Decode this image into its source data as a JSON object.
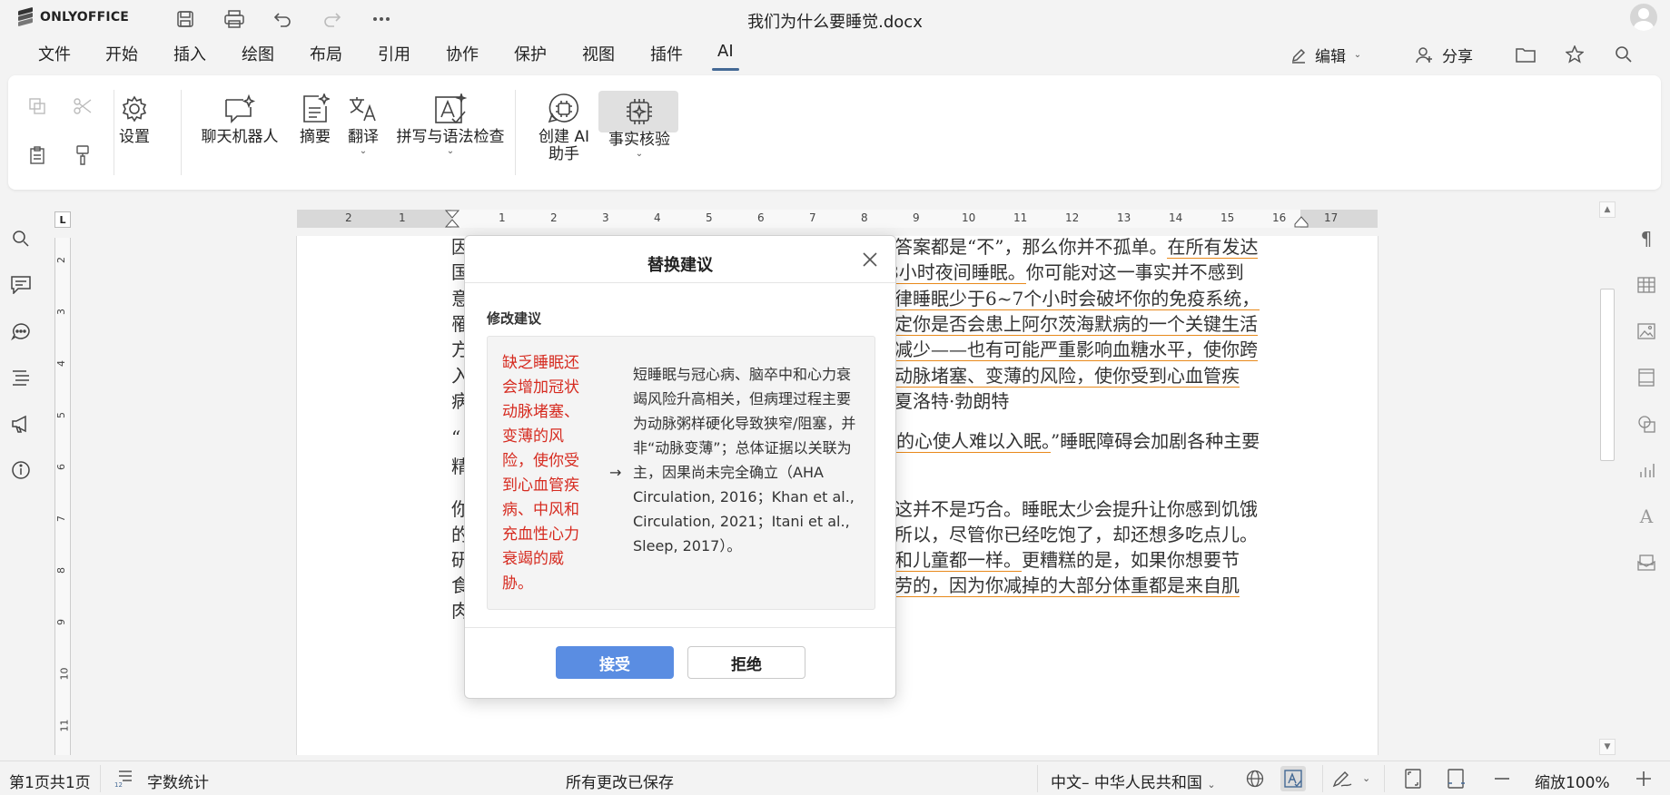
{
  "app": {
    "name": "ONLYOFFICE",
    "doc_title": "我们为什么要睡觉.docx"
  },
  "menu": {
    "tabs": [
      "文件",
      "开始",
      "插入",
      "绘图",
      "布局",
      "引用",
      "协作",
      "保护",
      "视图",
      "插件",
      "AI"
    ],
    "active": "AI",
    "edit_label": "编辑",
    "share_label": "分享"
  },
  "toolbar": {
    "settings": "设置",
    "chatbot": "聊天机器人",
    "summary": "摘要",
    "translate": "翻译",
    "spellcheck": "拼写与语法检查",
    "create_ai_l1": "创建 AI",
    "create_ai_l2": "助手",
    "factcheck": "事实核验"
  },
  "ruler": {
    "left_marks": [
      "2",
      "1"
    ],
    "marks": [
      "1",
      "2",
      "3",
      "4",
      "5",
      "6",
      "7",
      "8",
      "9",
      "10",
      "11",
      "12",
      "13",
      "14",
      "15",
      "16",
      "17"
    ],
    "vmarks": [
      "2",
      "3",
      "4",
      "5",
      "6",
      "7",
      "8",
      "9",
      "10",
      "11"
    ],
    "corner": "L"
  },
  "document": {
    "lines": [
      {
        "l": "因",
        "r": [
          [
            "答案都是“不”，那么你并不孤单。",
            false
          ],
          [
            "在所有发达",
            true
          ]
        ]
      },
      {
        "l": "国",
        "r": [
          [
            "8小时夜间睡眠。",
            true
          ],
          [
            "你可能对这一事实并不感到",
            false
          ]
        ]
      },
      {
        "l": "意",
        "r": [
          [
            "律睡眠少于6~7个小时会破坏你的免疫系统，",
            true
          ]
        ]
      },
      {
        "l": "罹",
        "r": [
          [
            "定你是否会患上阿尔茨海默病的一个关键生活",
            true
          ]
        ]
      },
      {
        "l": "方",
        "r": [
          [
            "减少——也有可能严重影响血糖水平，使你跨",
            true
          ]
        ]
      },
      {
        "l": "入",
        "r": [
          [
            "动脉堵塞、变薄的风险，使你受到心血管疾",
            true
          ]
        ]
      },
      {
        "l": "病",
        "r": [
          [
            "夏洛特·勃朗特",
            false
          ]
        ]
      },
      {
        "l": "“",
        "r": [
          [
            "的心使人难以入眠。",
            true
          ],
          [
            "”睡眠障碍会加剧各种主要",
            false
          ]
        ]
      },
      {
        "l": "精",
        "r": []
      },
      {
        "l": "你",
        "r": [
          [
            "这并不是巧合。睡眠太少会提升让你感到饥饿",
            false
          ]
        ]
      },
      {
        "l": "的",
        "r": [
          [
            "所以，尽管你已经吃饱了，却还想多吃点儿。",
            false
          ]
        ]
      },
      {
        "l": "研",
        "r": [
          [
            "和儿童都一样。",
            true
          ],
          [
            "更糟糕的是，如果你想要节",
            false
          ]
        ]
      },
      {
        "l": "食",
        "r": [
          [
            "劳的，因为你减掉的大部分体重都是来自肌",
            true
          ]
        ]
      },
      {
        "l": "肉",
        "r": []
      }
    ]
  },
  "dialog": {
    "title": "替换建议",
    "section_label": "修改建议",
    "original": "缺乏睡眠还会增加冠状动脉堵塞、变薄的风险，使你受到心血管疾病、中风和充血性心力衰竭的威胁。",
    "arrow": "→",
    "suggestion": "短睡眠与冠心病、脑卒中和心力衰竭风险升高相关，但病理过程主要为动脉粥样硬化导致狭窄/阻塞，并非“动脉变薄”；总体证据以关联为主，因果尚未完全确立（AHA Circulation, 2016；Khan et al., Circulation, 2021；Itani et al., Sleep, 2017）。",
    "accept": "接受",
    "reject": "拒绝"
  },
  "status": {
    "page": "第1页共1页",
    "word_count": "字数统计",
    "saved": "所有更改已保存",
    "language": "中文– 中华人民共和国",
    "zoom": "缩放100%"
  },
  "colors": {
    "accent": "#446995",
    "underline": "#e8891b",
    "error_text": "#d62b20",
    "accept_button": "#5a8de2"
  }
}
